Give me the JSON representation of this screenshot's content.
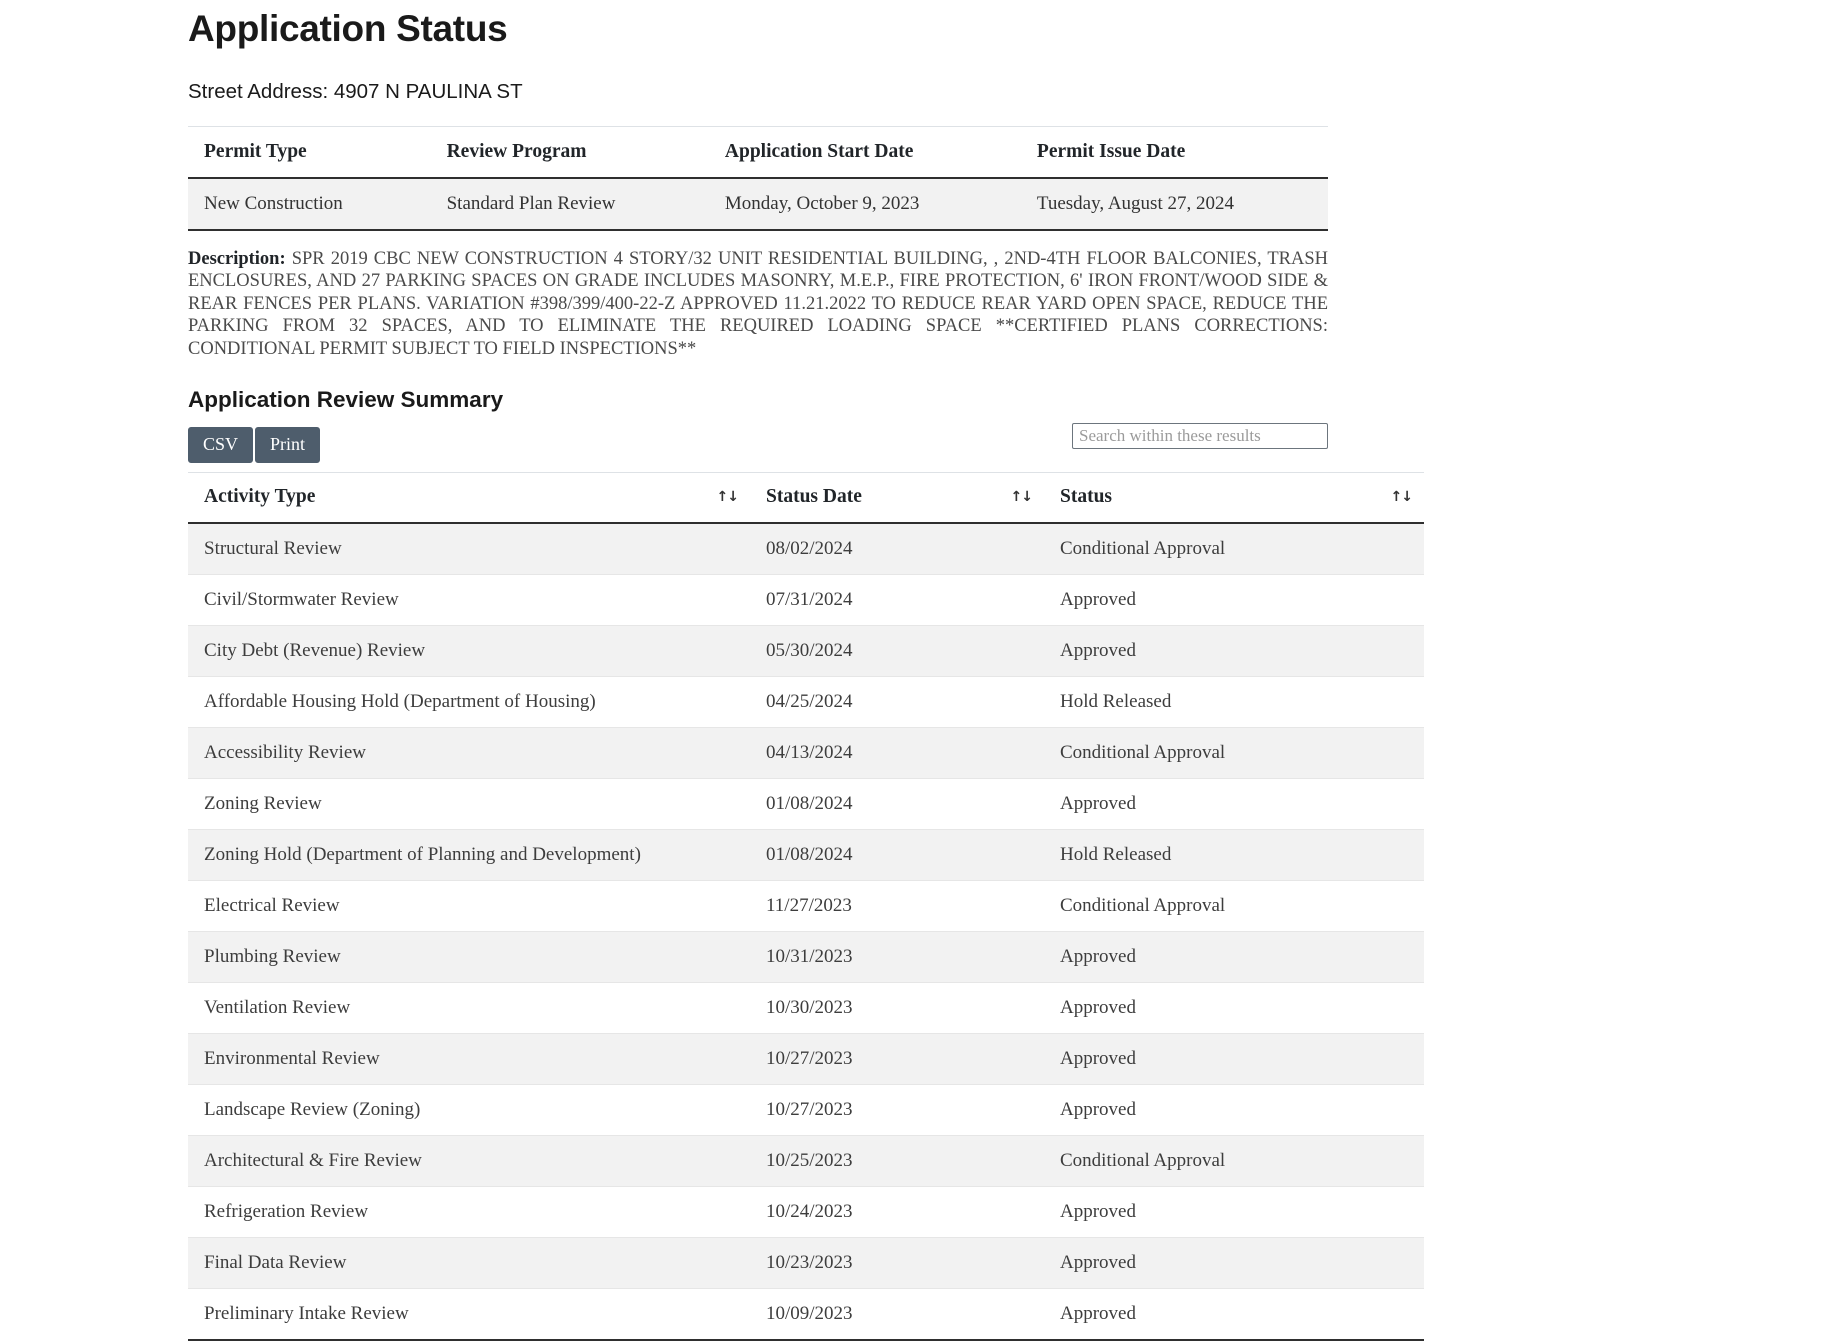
{
  "header": {
    "title": "Application Status",
    "street_address_label": "Street Address:",
    "street_address_value": "4907 N PAULINA ST",
    "street_address_line": "Street Address: 4907 N PAULINA ST"
  },
  "permit_table": {
    "columns": [
      "Permit Type",
      "Review Program",
      "Application Start Date",
      "Permit Issue Date"
    ],
    "row": {
      "permit_type": "New Construction",
      "review_program": "Standard Plan Review",
      "application_start_date": "Monday, October 9, 2023",
      "permit_issue_date": "Tuesday, August 27, 2024"
    }
  },
  "description": {
    "label": "Description:",
    "text": "SPR 2019 CBC NEW CONSTRUCTION 4 STORY/32 UNIT RESIDENTIAL BUILDING, , 2ND-4TH FLOOR BALCONIES, TRASH ENCLOSURES, AND 27 PARKING SPACES ON GRADE INCLUDES MASONRY, M.E.P., FIRE PROTECTION, 6' IRON FRONT/WOOD SIDE & REAR FENCES PER PLANS. VARIATION #398/399/400-22-Z APPROVED 11.21.2022 TO REDUCE REAR YARD OPEN SPACE, REDUCE THE PARKING FROM 32 SPACES, AND TO ELIMINATE THE REQUIRED LOADING SPACE **CERTIFIED PLANS CORRECTIONS: CONDITIONAL PERMIT SUBJECT TO FIELD INSPECTIONS**"
  },
  "review_summary": {
    "title": "Application Review Summary",
    "toolbar": {
      "csv_label": "CSV",
      "print_label": "Print",
      "search_placeholder": "Search within these results",
      "search_value": ""
    },
    "columns": [
      "Activity Type",
      "Status Date",
      "Status"
    ],
    "sort_icon": "↑↓",
    "rows": [
      {
        "activity": "Structural Review",
        "date": "08/02/2024",
        "status": "Conditional Approval"
      },
      {
        "activity": "Civil/Stormwater Review",
        "date": "07/31/2024",
        "status": "Approved"
      },
      {
        "activity": "City Debt (Revenue) Review",
        "date": "05/30/2024",
        "status": "Approved"
      },
      {
        "activity": "Affordable Housing Hold (Department of Housing)",
        "date": "04/25/2024",
        "status": "Hold Released"
      },
      {
        "activity": "Accessibility Review",
        "date": "04/13/2024",
        "status": "Conditional Approval"
      },
      {
        "activity": "Zoning Review",
        "date": "01/08/2024",
        "status": "Approved"
      },
      {
        "activity": "Zoning Hold (Department of Planning and Development)",
        "date": "01/08/2024",
        "status": "Hold Released"
      },
      {
        "activity": "Electrical Review",
        "date": "11/27/2023",
        "status": "Conditional Approval"
      },
      {
        "activity": "Plumbing Review",
        "date": "10/31/2023",
        "status": "Approved"
      },
      {
        "activity": "Ventilation Review",
        "date": "10/30/2023",
        "status": "Approved"
      },
      {
        "activity": "Environmental Review",
        "date": "10/27/2023",
        "status": "Approved"
      },
      {
        "activity": "Landscape Review (Zoning)",
        "date": "10/27/2023",
        "status": "Approved"
      },
      {
        "activity": "Architectural & Fire Review",
        "date": "10/25/2023",
        "status": "Conditional Approval"
      },
      {
        "activity": "Refrigeration Review",
        "date": "10/24/2023",
        "status": "Approved"
      },
      {
        "activity": "Final Data Review",
        "date": "10/23/2023",
        "status": "Approved"
      },
      {
        "activity": "Preliminary Intake Review",
        "date": "10/09/2023",
        "status": "Approved"
      }
    ]
  },
  "colors": {
    "button_bg": "#4e5d6c",
    "row_stripe": "#f2f2f2",
    "rule": "#2f2f2f"
  }
}
